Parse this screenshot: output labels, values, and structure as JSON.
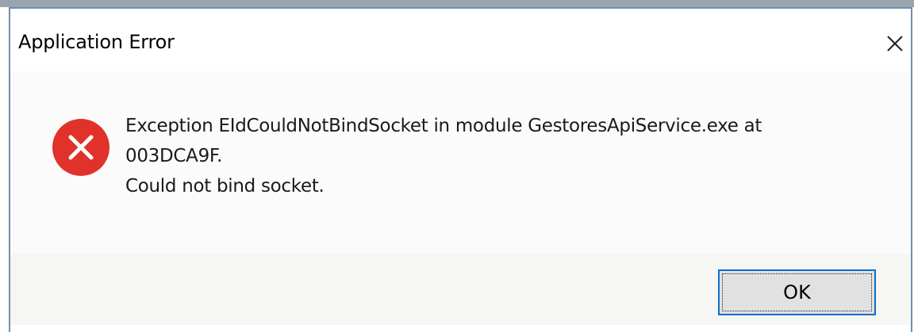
{
  "window": {
    "title": "Application Error",
    "close_icon": "close-icon"
  },
  "dialog": {
    "icon": "error-icon",
    "icon_color": "#e0322a",
    "message_lines": [
      "Exception EIdCouldNotBindSocket in module GestoresApiService.exe at",
      "003DCA9F.",
      "Could not bind socket."
    ]
  },
  "buttons": {
    "ok_label": "OK"
  },
  "colors": {
    "focus_border": "#0a70d0",
    "window_border": "#6d8fb8"
  }
}
